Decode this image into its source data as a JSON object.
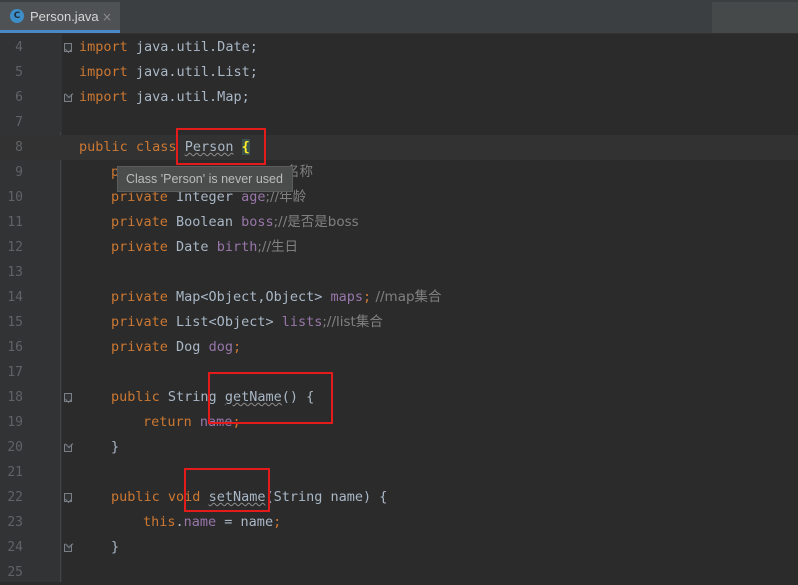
{
  "tab": {
    "icon_letter": "C",
    "label": "Person.java",
    "close": "×"
  },
  "tooltip": {
    "text": "Class 'Person' is never used"
  },
  "lines": {
    "l4": {
      "num": "4",
      "kw": "import",
      "rest": " java.util.Date;"
    },
    "l5": {
      "num": "5",
      "kw": "import",
      "rest": " java.util.List;"
    },
    "l6": {
      "num": "6",
      "kw": "import",
      "rest": " java.util.Map;"
    },
    "l7": {
      "num": "7"
    },
    "l8": {
      "num": "8",
      "kw1": "public",
      "kw2": "class",
      "name": "Person",
      "brace": "{"
    },
    "l9": {
      "num": "9",
      "kw": "p",
      "rest": "名称"
    },
    "l10": {
      "num": "10",
      "kw": "private",
      "type": "Integer",
      "field": "age",
      "comment": ";//年龄"
    },
    "l11": {
      "num": "11",
      "kw": "private",
      "type": "Boolean",
      "field": "boss",
      "comment": ";//是否是boss"
    },
    "l12": {
      "num": "12",
      "kw": "private",
      "type": "Date",
      "field": "birth",
      "comment": ";//生日"
    },
    "l13": {
      "num": "13"
    },
    "l14": {
      "num": "14",
      "kw": "private",
      "type": "Map<Object,Object>",
      "field": "maps",
      "semi": ";",
      "comment": " //map集合"
    },
    "l15": {
      "num": "15",
      "kw": "private",
      "type": "List<Object>",
      "field": "lists",
      "comment": ";//list集合"
    },
    "l16": {
      "num": "16",
      "kw": "private",
      "type": "Dog",
      "field": "dog",
      "semi": ";"
    },
    "l17": {
      "num": "17"
    },
    "l18": {
      "num": "18",
      "kw": "public",
      "type": "String",
      "method": "getName",
      "rest": "() {"
    },
    "l19": {
      "num": "19",
      "kw": "return",
      "field": "name",
      "semi": ";"
    },
    "l20": {
      "num": "20",
      "rest": "}"
    },
    "l21": {
      "num": "21"
    },
    "l22": {
      "num": "22",
      "kw1": "public",
      "kw2": "void",
      "method": "setName",
      "rest": "(String name) {"
    },
    "l23": {
      "num": "23",
      "kw": "this",
      "dot": ".",
      "field": "name",
      "rest": " = name",
      "semi": ";"
    },
    "l24": {
      "num": "24",
      "rest": "}"
    },
    "l25": {
      "num": "25"
    }
  }
}
